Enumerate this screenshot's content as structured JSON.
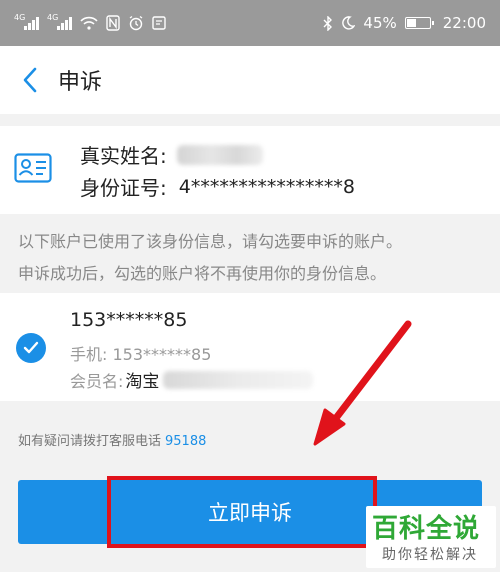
{
  "status_bar": {
    "signal_1_label": "4G",
    "signal_2_label": "4G",
    "battery": "45%",
    "time": "22:00"
  },
  "nav": {
    "title": "申诉"
  },
  "identity": {
    "name_label": "真实姓名:",
    "id_label": "身份证号:",
    "id_value": "4****************8"
  },
  "notice": {
    "line1": "以下账户已使用了该身份信息，请勾选要申诉的账户。",
    "line2": "申诉成功后，勾选的账户将不再使用你的身份信息。"
  },
  "account": {
    "number": "153******85",
    "phone_label": "手机:",
    "phone_value": "153******85",
    "member_label": "会员名:",
    "member_value": "淘宝",
    "checked": true
  },
  "help": {
    "text": "如有疑问请拨打客服电话",
    "phone": "95188"
  },
  "submit": {
    "label": "立即申诉"
  },
  "watermark": {
    "title": "百科全说",
    "subtitle": "助你轻松解决"
  },
  "colors": {
    "accent": "#1b8fe6",
    "annotation": "#e0131b",
    "watermark": "#2fa836"
  }
}
